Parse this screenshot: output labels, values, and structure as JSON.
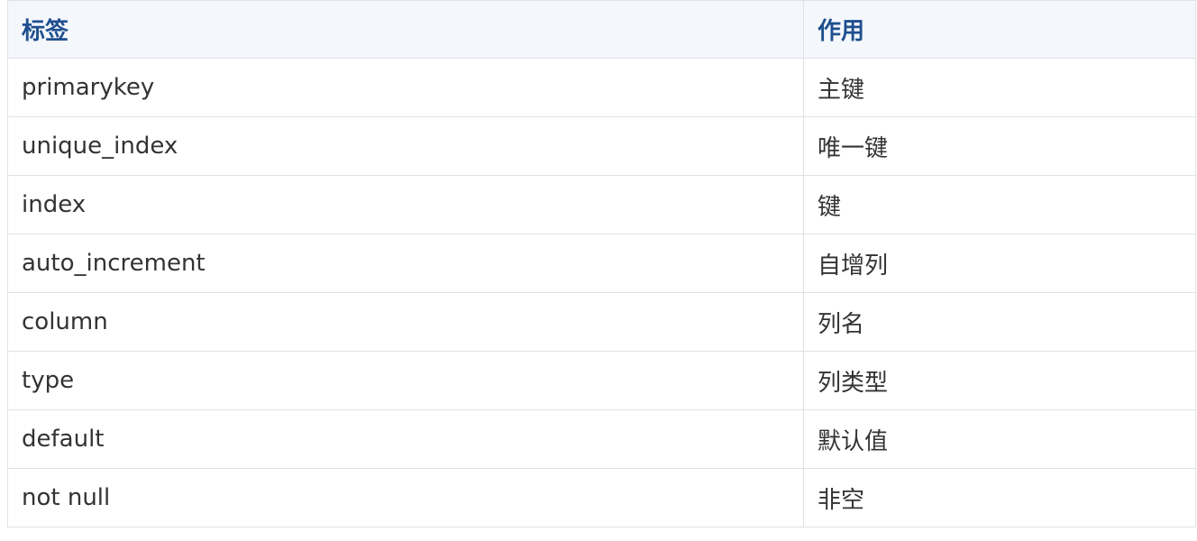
{
  "table": {
    "headers": [
      "标签",
      "作用"
    ],
    "rows": [
      [
        "primarykey",
        "主键"
      ],
      [
        "unique_index",
        "唯一键"
      ],
      [
        "index",
        "键"
      ],
      [
        "auto_increment",
        "自增列"
      ],
      [
        "column",
        "列名"
      ],
      [
        "type",
        "列类型"
      ],
      [
        "default",
        "默认值"
      ],
      [
        "not null",
        "非空"
      ]
    ]
  },
  "colors": {
    "header_bg": "#f4f7fb",
    "header_text": "#1f4f8f",
    "border": "#dfe2e5",
    "cell_text": "#333333"
  }
}
